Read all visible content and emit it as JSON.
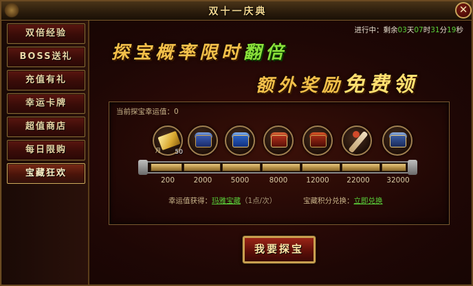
{
  "window": {
    "title": "双十一庆典",
    "close_symbol": "✕"
  },
  "sidebar": {
    "items": [
      {
        "label": "双倍经验"
      },
      {
        "label": "BOSS送礼"
      },
      {
        "label": "充值有礼"
      },
      {
        "label": "幸运卡牌"
      },
      {
        "label": "超值商店"
      },
      {
        "label": "每日限购"
      },
      {
        "label": "宝藏狂欢"
      }
    ],
    "active_index": 6
  },
  "timer": {
    "prefix": "进行中：剩余",
    "days": "03",
    "days_unit": "天",
    "hours": "07",
    "hours_unit": "时",
    "minutes": "31",
    "minutes_unit": "分",
    "seconds": "19",
    "seconds_unit": "秒"
  },
  "banner": {
    "line1_main": "探宝概率限时",
    "line1_highlight": "翻倍",
    "line2_main": "额外奖励",
    "line2_highlight": "免费领"
  },
  "panel": {
    "luck_label": "当前探宝幸运值：0",
    "rewards": [
      {
        "icon": "gold-scroll-icon",
        "tag": "月",
        "quantity": "50"
      },
      {
        "icon": "blue-chest-icon",
        "tag": "",
        "quantity": ""
      },
      {
        "icon": "blue-chest-icon",
        "tag": "",
        "quantity": ""
      },
      {
        "icon": "red-chest-icon",
        "tag": "",
        "quantity": ""
      },
      {
        "icon": "red-chest-icon",
        "tag": "",
        "quantity": ""
      },
      {
        "icon": "bone-weapon-icon",
        "tag": "",
        "quantity": ""
      },
      {
        "icon": "blue-gold-chest-icon",
        "tag": "",
        "quantity": ""
      }
    ],
    "thresholds": [
      "200",
      "2000",
      "5000",
      "8000",
      "12000",
      "22000",
      "32000"
    ],
    "luck_progress": 0,
    "luck_source_label": "幸运值获得：",
    "luck_source_link": "玛雅宝藏",
    "luck_source_rate": "（1点/次）",
    "exchange_label": "宝藏积分兑换：",
    "exchange_link": "立即兑换"
  },
  "treasure_button": {
    "label": "我要探宝"
  },
  "colors": {
    "accent_green": "#5ad23a",
    "gold": "#f2c04a",
    "frame": "#8a6a34"
  }
}
